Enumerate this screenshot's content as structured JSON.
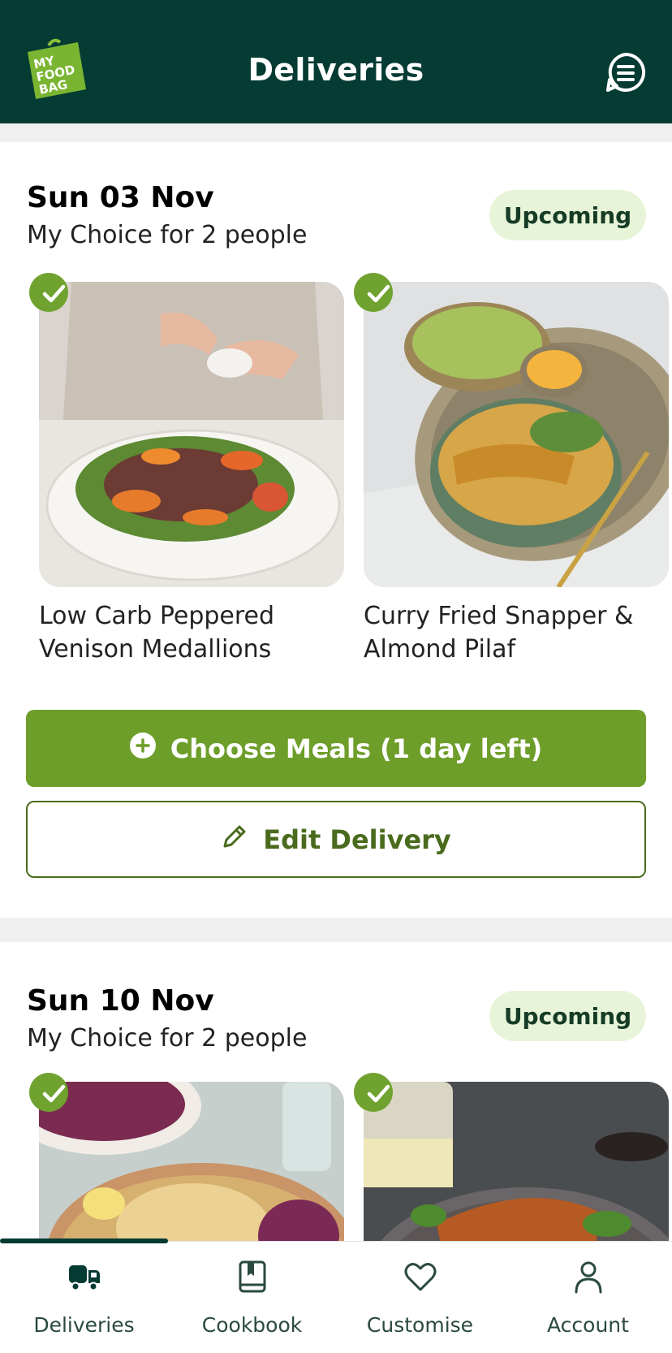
{
  "header": {
    "title": "Deliveries",
    "logo_text": [
      "MY",
      "FOOD",
      "BAG"
    ]
  },
  "deliveries": [
    {
      "date": "Sun 03 Nov",
      "plan": "My Choice for 2 people",
      "status": "Upcoming",
      "meals": [
        {
          "name_line1": "Low Carb Peppered",
          "name_line2": "Venison Medallions"
        },
        {
          "name_line1": "Curry Fried Snapper &",
          "name_line2": "Almond Pilaf"
        }
      ],
      "choose_label": "Choose Meals (1 day left)",
      "edit_label": "Edit Delivery"
    },
    {
      "date": "Sun 10 Nov",
      "plan": "My Choice for 2 people",
      "status": "Upcoming"
    }
  ],
  "tabs": [
    {
      "label": "Deliveries",
      "icon": "truck-icon"
    },
    {
      "label": "Cookbook",
      "icon": "book-icon"
    },
    {
      "label": "Customise",
      "icon": "heart-icon"
    },
    {
      "label": "Account",
      "icon": "person-icon"
    }
  ],
  "colors": {
    "header": "#043b33",
    "primary_green": "#6e9e2a",
    "badge_bg": "#e8f4d8"
  }
}
